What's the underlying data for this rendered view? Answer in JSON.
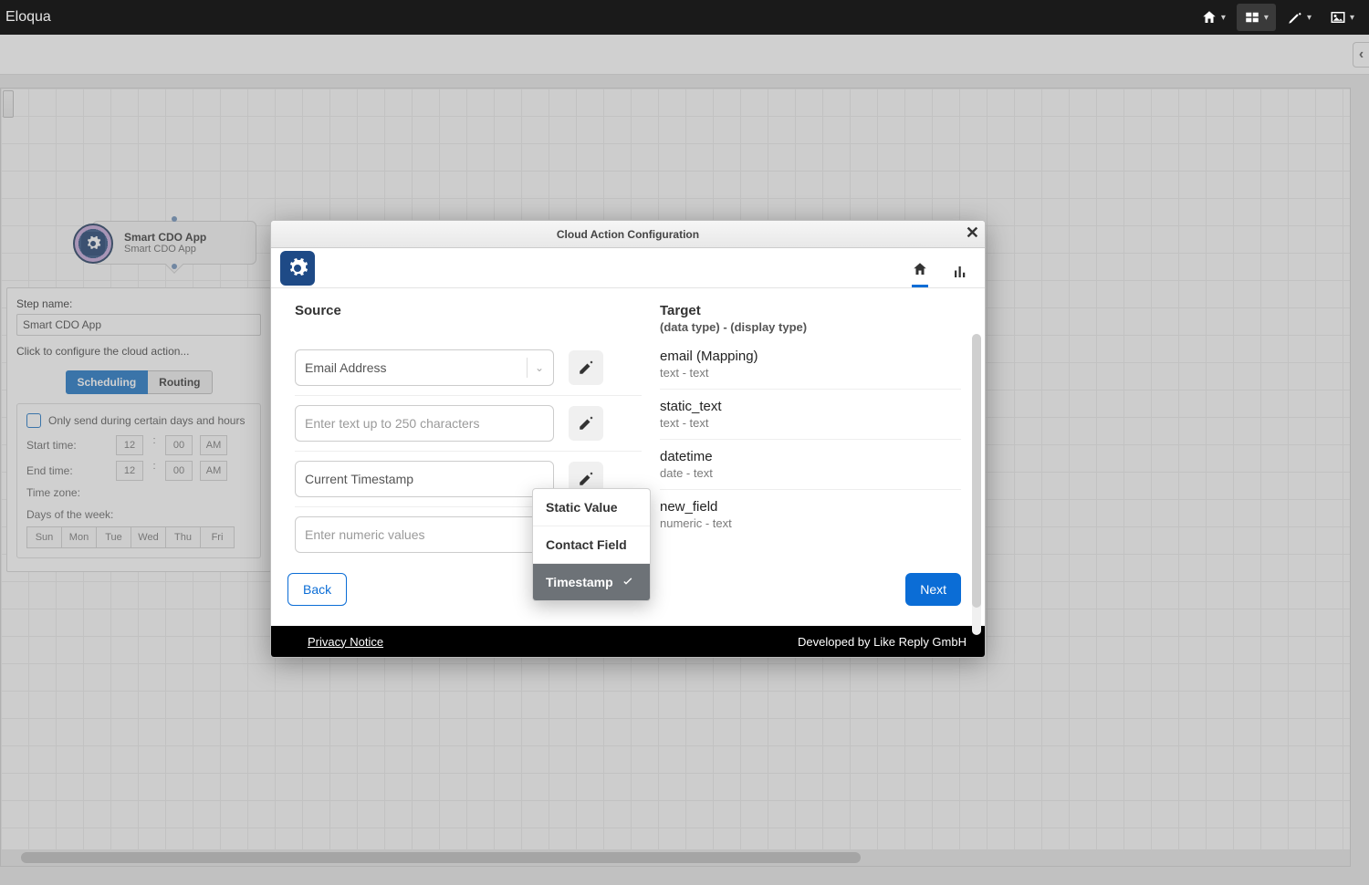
{
  "topbar": {
    "brand": "Eloqua"
  },
  "node": {
    "title": "Smart CDO App",
    "subtitle": "Smart CDO App"
  },
  "panel": {
    "step_name_label": "Step name:",
    "step_name_value": "Smart CDO App",
    "hint": "Click to configure the cloud action...",
    "tab_scheduling": "Scheduling",
    "tab_routing": "Routing",
    "only_send_label": "Only send during certain days and hours",
    "start_label": "Start time:",
    "end_label": "End time:",
    "tz_label": "Time zone:",
    "days_label": "Days of the week:",
    "hour": "12",
    "minute": "00",
    "ampm": "AM",
    "days": [
      "Sun",
      "Mon",
      "Tue",
      "Wed",
      "Thu",
      "Fri"
    ]
  },
  "modal": {
    "title": "Cloud Action Configuration",
    "source_title": "Source",
    "target_title": "Target",
    "target_sub": "(data type) - (display type)",
    "back": "Back",
    "next": "Next",
    "privacy": "Privacy Notice",
    "developed_by": "Developed by Like Reply GmbH",
    "popover": {
      "static": "Static Value",
      "contact": "Contact Field",
      "timestamp": "Timestamp"
    },
    "rows": [
      {
        "source_type": "select",
        "source_value": "Email Address",
        "target_name": "email (Mapping)",
        "target_type": "text - text"
      },
      {
        "source_type": "input",
        "source_placeholder": "Enter text up to 250 characters",
        "target_name": "static_text",
        "target_type": "text - text"
      },
      {
        "source_type": "input",
        "source_value": "Current Timestamp",
        "target_name": "datetime",
        "target_type": "date - text"
      },
      {
        "source_type": "input",
        "source_placeholder": "Enter numeric values",
        "target_name": "new_field",
        "target_type": "numeric - text"
      }
    ]
  }
}
